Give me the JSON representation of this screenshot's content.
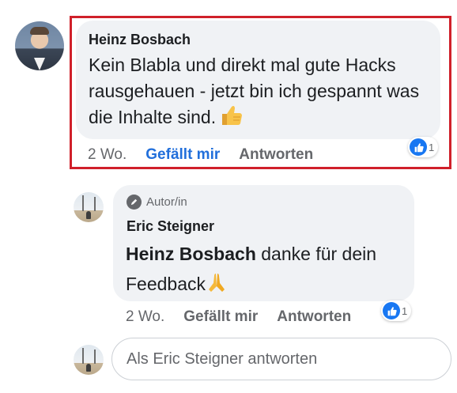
{
  "main_comment": {
    "author": "Heinz Bosbach",
    "text": "Kein Blabla und direkt mal gute Hacks rausgehauen - jetzt bin ich gespannt was die Inhalte sind.",
    "emoji": "thumbs-up-emoji",
    "time": "2 Wo.",
    "like_label": "Gefällt mir",
    "reply_label": "Antworten",
    "reaction_count": "1",
    "reaction_icon": "like-icon",
    "highlight_color": "#d0202a"
  },
  "reply_comment": {
    "badge_label": "Autor/in",
    "badge_icon": "pen-icon",
    "author": "Eric Steigner",
    "mention": "Heinz Bosbach",
    "text": "danke für dein Feedback",
    "emoji": "praying-hands-emoji",
    "time": "2 Wo.",
    "like_label": "Gefällt mir",
    "reply_label": "Antworten",
    "reaction_count": "1",
    "reaction_icon": "like-icon"
  },
  "reply_input": {
    "placeholder": "Als Eric Steigner antworten"
  },
  "colors": {
    "bubble": "#f0f2f5",
    "like_active": "#216fdb",
    "meta_text": "#65676b",
    "reaction_blue": "#1877f2"
  }
}
